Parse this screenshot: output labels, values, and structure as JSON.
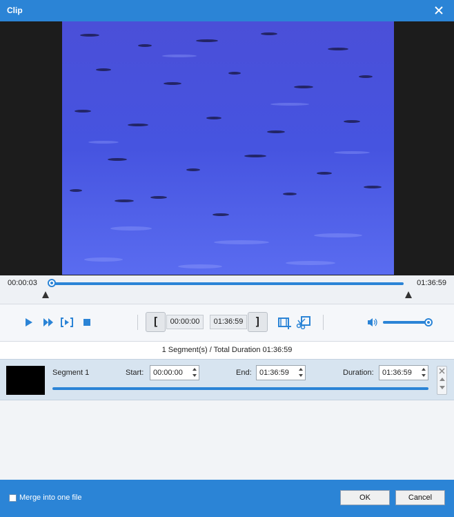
{
  "window": {
    "title": "Clip"
  },
  "timeline": {
    "current_time": "00:00:03",
    "end_time": "01:36:59",
    "position_fraction": 0.0
  },
  "controls": {
    "start_time": "00:00:00",
    "end_time": "01:36:59",
    "volume_fraction": 1.0
  },
  "summary": {
    "text": "1 Segment(s) / Total Duration 01:36:59"
  },
  "segments": [
    {
      "name": "Segment 1",
      "start_label": "Start:",
      "start": "00:00:00",
      "end_label": "End:",
      "end": "01:36:59",
      "duration_label": "Duration:",
      "duration": "01:36:59"
    }
  ],
  "footer": {
    "merge_label": "Merge into one file",
    "merge_checked": false,
    "ok_label": "OK",
    "cancel_label": "Cancel"
  },
  "colors": {
    "accent": "#2b84d6",
    "preview_background": "#1c1c1c",
    "segment_row": "#d7e4f0"
  }
}
